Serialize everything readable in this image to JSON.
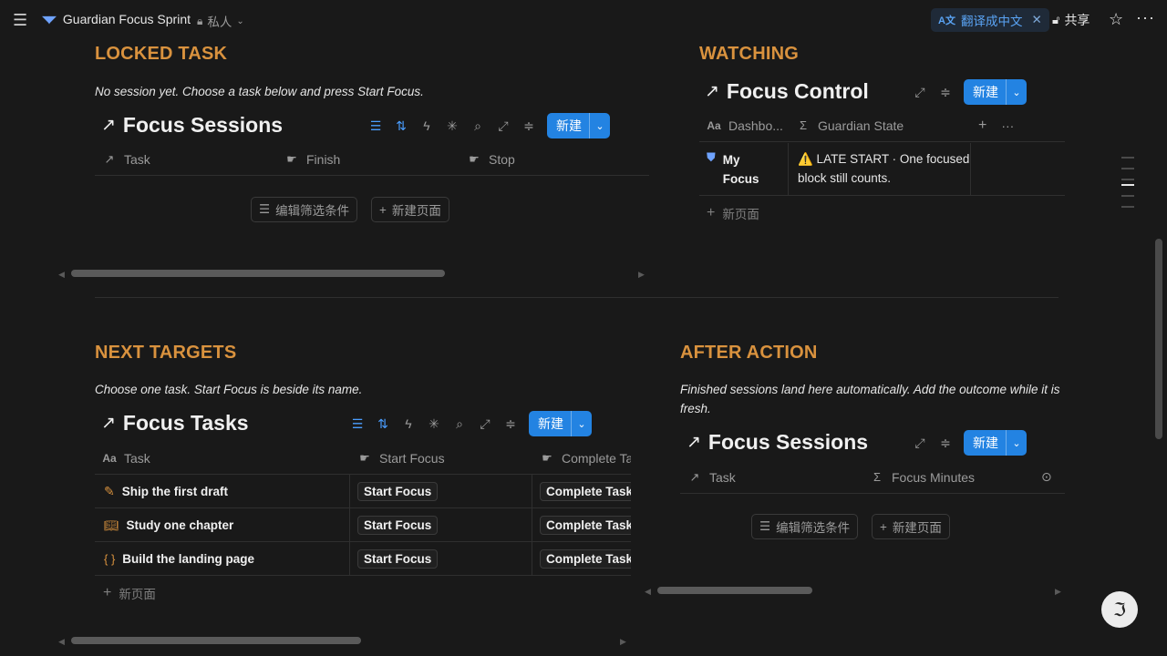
{
  "topbar": {
    "menu_icon": "menu-icon",
    "page_icon": "mask-icon",
    "page_title": "Guardian Focus Sprint",
    "privacy_label": "私人",
    "translate_label": "翻译成中文",
    "share_label": "共享"
  },
  "locked": {
    "heading": "LOCKED TASK",
    "subtitle": "No session yet. Choose a task below and press Start Focus.",
    "db_title": "Focus Sessions",
    "new_label": "新建",
    "columns": [
      "Task",
      "Finish",
      "Stop"
    ],
    "filter_label": "编辑筛选条件",
    "newpage_label": "新建页面"
  },
  "watching": {
    "heading": "WATCHING",
    "db_title": "Focus Control",
    "new_label": "新建",
    "columns": [
      "Dashbo...",
      "Guardian State"
    ],
    "row": {
      "name": "My Focus",
      "state": "⚠️ LATE START · One focused block still counts."
    },
    "add_page": "新页面"
  },
  "next": {
    "heading": "NEXT TARGETS",
    "subtitle": "Choose one task. Start Focus is beside its name.",
    "db_title": "Focus Tasks",
    "new_label": "新建",
    "columns": [
      "Task",
      "Start Focus",
      "Complete Ta"
    ],
    "rows": [
      {
        "task": "Ship the first draft",
        "icon": "pencil-icon",
        "start": "Start Focus",
        "complete": "Complete Task"
      },
      {
        "task": "Study one chapter",
        "icon": "book-icon",
        "start": "Start Focus",
        "complete": "Complete Task"
      },
      {
        "task": "Build the landing page",
        "icon": "code-braces-icon",
        "start": "Start Focus",
        "complete": "Complete Task"
      }
    ],
    "add_page": "新页面"
  },
  "after": {
    "heading": "AFTER ACTION",
    "subtitle": "Finished sessions land here automatically. Add the outcome while it is fresh.",
    "db_title": "Focus Sessions",
    "new_label": "新建",
    "columns": [
      "Task",
      "Focus Minutes"
    ],
    "filter_label": "编辑筛选条件",
    "newpage_label": "新建页面"
  },
  "colors": {
    "accent": "#2383e2",
    "heading": "#d9923e",
    "background": "#191919"
  }
}
